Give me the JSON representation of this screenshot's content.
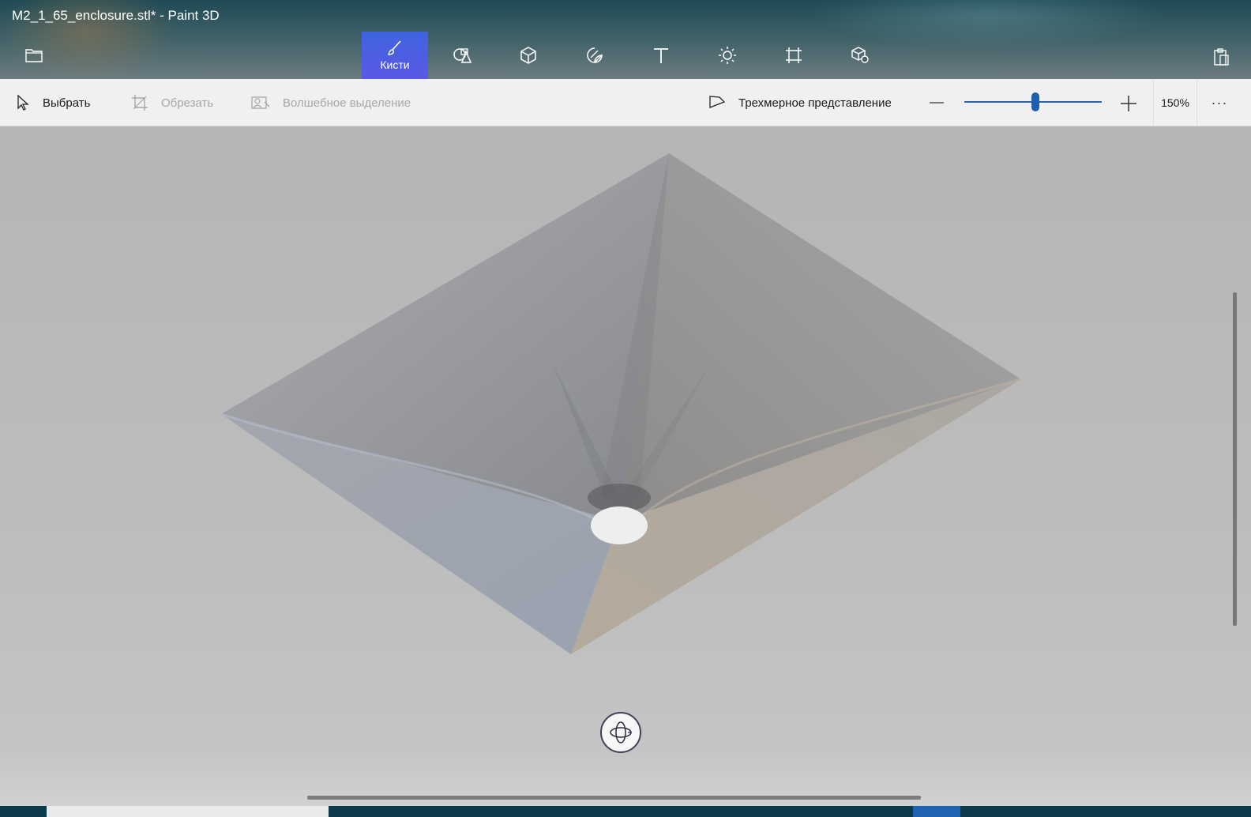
{
  "window": {
    "title": "M2_1_65_enclosure.stl* - Paint 3D"
  },
  "ribbon": {
    "menu_icon": "folder-icon",
    "tools": [
      {
        "name": "tool-brushes",
        "icon": "brush-icon",
        "label": "Кисти",
        "active": true
      },
      {
        "name": "tool-2d-shapes",
        "icon": "2d-shapes-icon",
        "label": "",
        "active": false
      },
      {
        "name": "tool-3d-shapes",
        "icon": "3d-cube-icon",
        "label": "",
        "active": false
      },
      {
        "name": "tool-stickers",
        "icon": "sticker-icon",
        "label": "",
        "active": false
      },
      {
        "name": "tool-text",
        "icon": "text-icon",
        "label": "",
        "active": false
      },
      {
        "name": "tool-effects",
        "icon": "sun-icon",
        "label": "",
        "active": false
      },
      {
        "name": "tool-canvas",
        "icon": "canvas-crop-icon",
        "label": "",
        "active": false
      },
      {
        "name": "tool-3d-library",
        "icon": "3d-library-icon",
        "label": "",
        "active": false
      }
    ],
    "paste_icon": "paste-icon"
  },
  "commandbar": {
    "select_label": "Выбрать",
    "crop_label": "Обрезать",
    "magic_select_label": "Волшебное выделение",
    "view3d_label": "Трехмерное представление",
    "zoom_value": "150%",
    "zoom_slider_fraction": 0.52,
    "more_label": "···"
  },
  "canvas": {
    "rotate_icon": "orbit-rotate-icon"
  },
  "colors": {
    "accent": "#3f64e0",
    "slider": "#1d5fae",
    "canvas_bg": "#b9bab9"
  }
}
